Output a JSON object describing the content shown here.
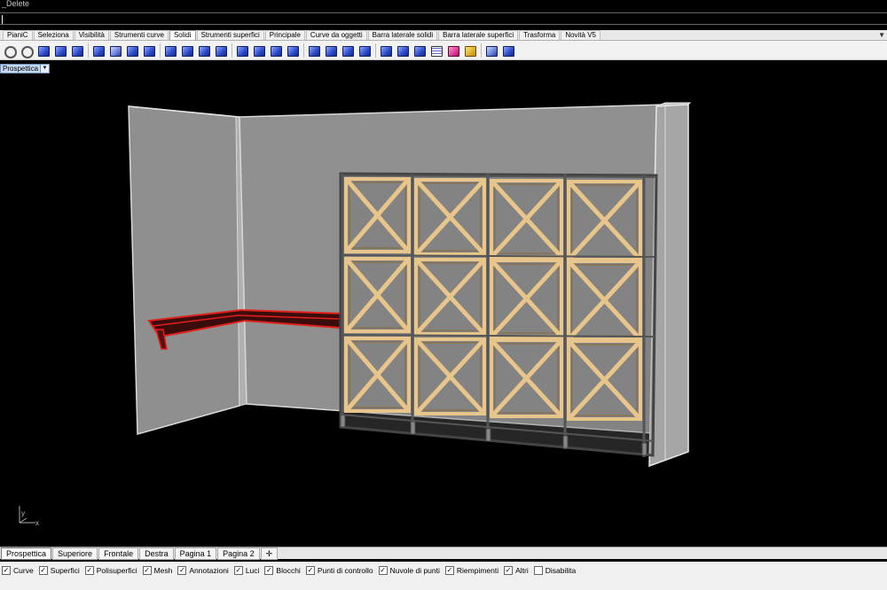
{
  "command": {
    "history": "_Delete",
    "prompt": ""
  },
  "toolbar_tabs": [
    "PianiC",
    "Seleziona",
    "Visibilità",
    "Strumenti curve",
    "Solidi",
    "Strumenti superfici",
    "Principale",
    "Curve da oggetti",
    "Barra laterale solidi",
    "Barra laterale superfici",
    "Trasforma",
    "Novità V5"
  ],
  "active_toolbar_tab": "Solidi",
  "toolbar_icons": [
    "fillet-edge-icon",
    "chamfer-edge-icon",
    "box-icon",
    "sphere-icon",
    "cylinder-icon",
    "cone-icon",
    "torus-icon",
    "pipe-icon",
    "extrude-icon",
    "boolean-union-icon",
    "boolean-difference-icon",
    "boolean-intersection-icon",
    "boolean-split-icon",
    "shell-icon",
    "cap-icon",
    "extract-surface-icon",
    "offset-surface-icon",
    "rib-icon",
    "slab-icon",
    "wire-cut-icon",
    "move-face-icon",
    "move-edge-icon",
    "split-face-icon",
    "merge-face-icon",
    "fold-face-icon",
    "make-hole-icon",
    "place-hole-icon",
    "rotate-hole-icon",
    "array-hole-icon",
    "grid-icon",
    "solid-edit-icon",
    "history-icon",
    "settings-icon"
  ],
  "viewport": {
    "title": "Prospettica",
    "axis_x": "x",
    "axis_y": "y",
    "background": "#000000",
    "selected_color": "#e0201a",
    "rack_color": "#e8c58a"
  },
  "view_tabs": [
    "Prospettica",
    "Superiore",
    "Frontale",
    "Destra",
    "Pagina 1",
    "Pagina 2"
  ],
  "active_view_tab": "Prospettica",
  "add_tab_glyph": "✛",
  "filters": [
    {
      "label": "Curve",
      "checked": true
    },
    {
      "label": "Superfici",
      "checked": true
    },
    {
      "label": "Polisuperfici",
      "checked": true
    },
    {
      "label": "Mesh",
      "checked": true
    },
    {
      "label": "Annotazioni",
      "checked": true
    },
    {
      "label": "Luci",
      "checked": true
    },
    {
      "label": "Blocchi",
      "checked": true
    },
    {
      "label": "Punti di controllo",
      "checked": true
    },
    {
      "label": "Nuvole di punti",
      "checked": true
    },
    {
      "label": "Riempimenti",
      "checked": true
    },
    {
      "label": "Altri",
      "checked": true
    },
    {
      "label": "Disabilita",
      "checked": false
    }
  ]
}
